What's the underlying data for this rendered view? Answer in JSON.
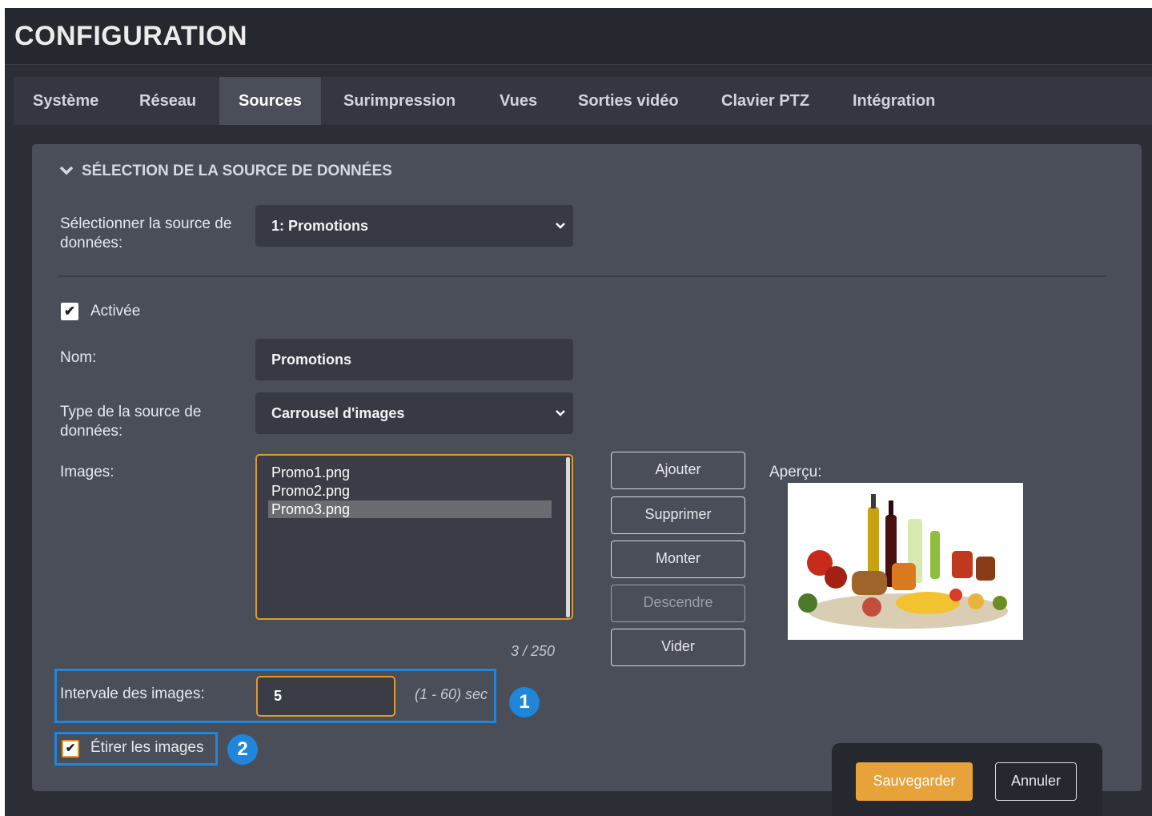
{
  "app": {
    "title": "CONFIGURATION"
  },
  "tabs": [
    {
      "label": "Système",
      "active": false
    },
    {
      "label": "Réseau",
      "active": false
    },
    {
      "label": "Sources",
      "active": true
    },
    {
      "label": "Surimpression",
      "active": false
    },
    {
      "label": "Vues",
      "active": false
    },
    {
      "label": "Sorties vidéo",
      "active": false
    },
    {
      "label": "Clavier PTZ",
      "active": false
    },
    {
      "label": "Intégration",
      "active": false
    }
  ],
  "section": {
    "title": "SÉLECTION DE LA SOURCE DE DONNÉES",
    "collapse_icon": "chevron-down-icon"
  },
  "source_select": {
    "label": "Sélectionner la source de données:",
    "value": "1: Promotions"
  },
  "enabled": {
    "label": "Activée",
    "checked": true
  },
  "name": {
    "label": "Nom:",
    "value": "Promotions"
  },
  "type": {
    "label": "Type de la source de données:",
    "value": "Carrousel d'images"
  },
  "images": {
    "label": "Images:",
    "items": [
      "Promo1.png",
      "Promo2.png",
      "Promo3.png"
    ],
    "selected_index": 2,
    "counter": "3 / 250"
  },
  "image_buttons": {
    "add": "Ajouter",
    "remove": "Supprimer",
    "up": "Monter",
    "down": "Descendre",
    "clear": "Vider"
  },
  "preview": {
    "label": "Aperçu:"
  },
  "interval": {
    "label": "Intervale des images:",
    "value": "5",
    "range": "(1 - 60) sec"
  },
  "stretch": {
    "label": "Étirer les images",
    "checked": true
  },
  "annotations": {
    "badge1": "1",
    "badge2": "2"
  },
  "footer": {
    "save": "Sauvegarder",
    "cancel": "Annuler"
  },
  "colors": {
    "accent": "#e8a23a",
    "highlight": "#1f86dc",
    "panel": "#4a4e59",
    "background": "#2b2e35"
  }
}
